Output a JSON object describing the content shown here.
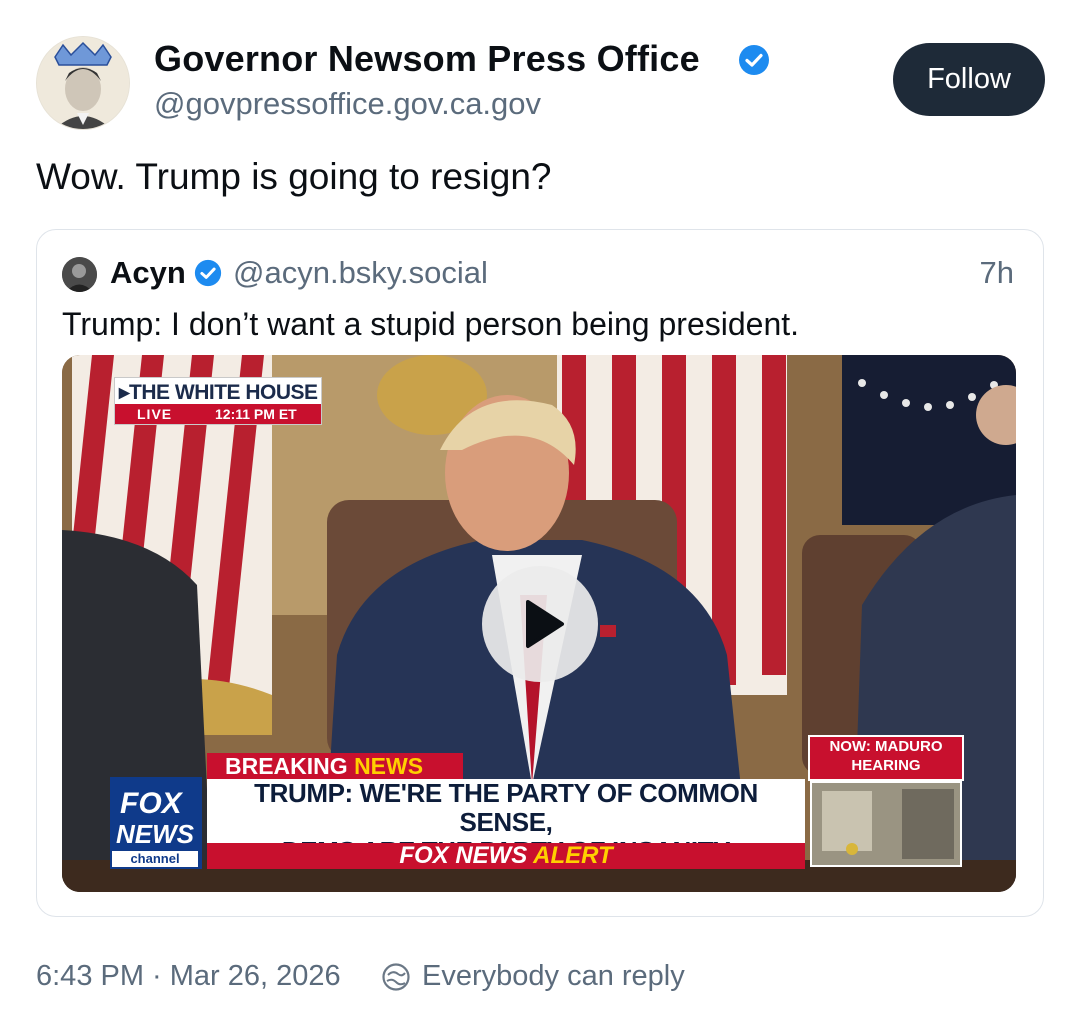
{
  "post": {
    "display_name": "Governor Newsom Press Office",
    "handle": "@govpressoffice.gov.ca.gov",
    "follow_label": "Follow",
    "text": "Wow. Trump is going to resign?",
    "timestamp": "6:43 PM · Mar 26, 2026",
    "reply_setting": "Everybody can reply"
  },
  "quote": {
    "display_name": "Acyn",
    "handle": "@acyn.bsky.social",
    "time": "7h",
    "text": "Trump: I don’t want a stupid person being president."
  },
  "video": {
    "wh_title": "▸THE WHITE HOUSE",
    "wh_live": "LIVE",
    "wh_time": "12:11 PM ET",
    "breaking_1": "BREAKING",
    "breaking_2": "NEWS",
    "headline_1": "TRUMP: WE'RE THE PARTY OF COMMON SENSE,",
    "headline_2": "DEMS ARE THE PARTY OF INSANITY",
    "alert_1": "FOX NEWS",
    "alert_2": "ALERT",
    "logo_1": "FOX",
    "logo_2": "NEWS",
    "logo_3": "channel",
    "side_1": "NOW: MADURO",
    "side_2": "HEARING UNDERWAY"
  },
  "colors": {
    "verified": "#1d8bf0",
    "follow_bg": "#1e2a38",
    "fox_red": "#c8102e",
    "fox_blue": "#0f3a8a",
    "alert_yellow": "#ffd000"
  },
  "icons": {
    "verified": "verified-badge-icon",
    "play": "play-icon",
    "reply": "everybody-reply-icon"
  }
}
